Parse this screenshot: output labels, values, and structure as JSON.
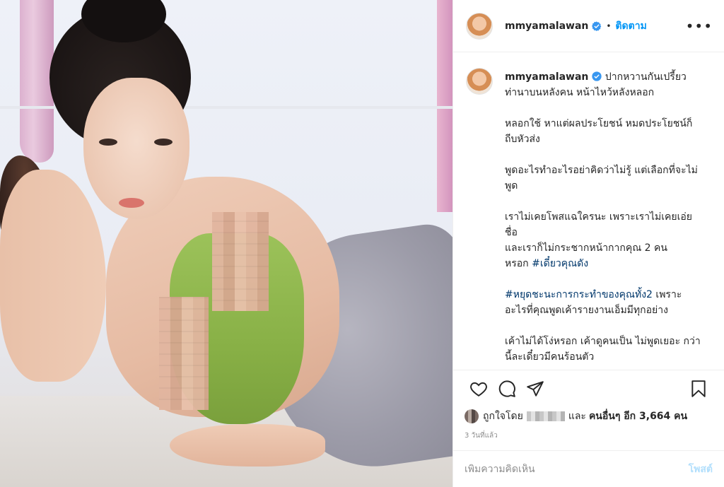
{
  "post": {
    "username": "mmyamalawan",
    "follow_label": "ติดตาม",
    "more_label": "•••",
    "caption_lines": "ปากหวานกันเปรี้ยว\nท่านาบนหลังคน หน้าไหว้หลังหลอก\n\nหลอกใช้ หาแต่ผลประโยชน์ หมดประโยชน์ก็ถีบหัวส่ง\n\nพูดอะไรทำอะไรอย่าคิดว่าไม่รู้ แต่เลือกที่จะไม่พูด\n\nเราไม่เคยโพสแฉใครนะ เพราะเราไม่เคยเอ่ยชื่อ\nและเราก็ไม่กระชากหน้ากากคุณ 2 คน\nหรอก ",
    "caption_tag_1": "#เดี๋ยวคุณดัง",
    "caption_tag_2": "#หยุดชะนะการกระทำของคุณทั้ง2",
    "caption_after_tag_2": " เพราะอะไรที่คุณพูดเค้ารายงานเอ็มมีทุกอย่าง\n\nเค้าไม่ได้โง่หรอก เค้าดูคนเป็น ไม่พูดเยอะ กว่านี้ละเดี๋ยวมีคนร้อนตัว",
    "likes_prefix": "ถูกใจโดย",
    "likes_and": "และ",
    "likes_others": "คนอื่นๆ อีก 3,664 คน",
    "time_ago": "3 วันที่แล้ว",
    "comment_placeholder": "เพิ่มความคิดเห็น",
    "post_label": "โพสต์"
  },
  "icons": {
    "verified": "verified-badge-icon",
    "like": "heart-icon",
    "comment": "comment-icon",
    "share": "share-icon",
    "save": "bookmark-icon"
  },
  "colors": {
    "link_blue": "#0095f6",
    "hashtag": "#00376b",
    "muted": "#8e8e8e",
    "post_disabled": "#b2dffc"
  }
}
